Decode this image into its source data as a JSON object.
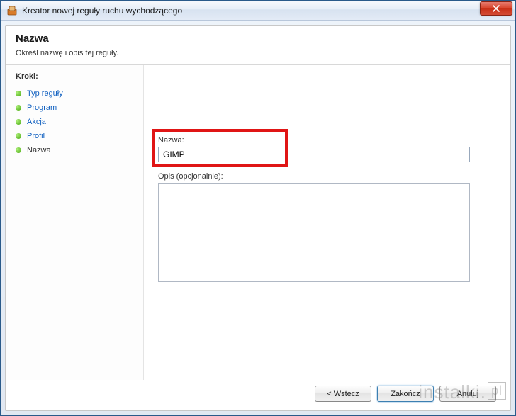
{
  "window": {
    "title": "Kreator nowej reguły ruchu wychodzącego"
  },
  "header": {
    "title": "Nazwa",
    "subtitle": "Określ nazwę i opis tej reguły."
  },
  "sidebar": {
    "heading": "Kroki:",
    "steps": [
      {
        "label": "Typ reguły",
        "current": false
      },
      {
        "label": "Program",
        "current": false
      },
      {
        "label": "Akcja",
        "current": false
      },
      {
        "label": "Profil",
        "current": false
      },
      {
        "label": "Nazwa",
        "current": true
      }
    ]
  },
  "form": {
    "name_label": "Nazwa:",
    "name_value": "GIMP",
    "desc_label": "Opis (opcjonalnie):",
    "desc_value": ""
  },
  "buttons": {
    "back": "< Wstecz",
    "finish": "Zakończ",
    "cancel": "Anuluj"
  },
  "watermark": {
    "text": "instalki.",
    "suffix": "pl"
  }
}
